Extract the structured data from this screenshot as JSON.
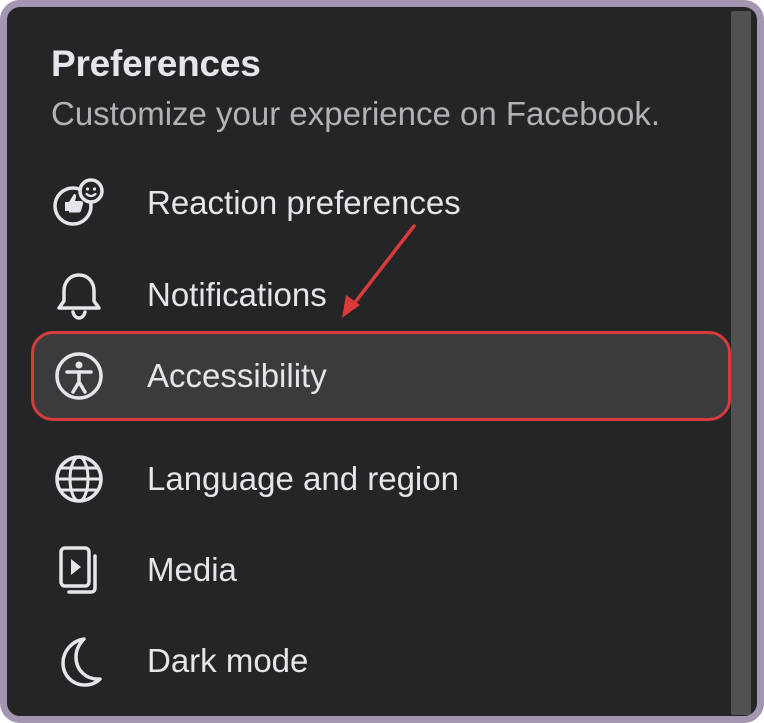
{
  "header": {
    "title": "Preferences",
    "subtitle": "Customize your experience on Facebook."
  },
  "items": [
    {
      "label": "Reaction preferences",
      "icon": "reaction-icon"
    },
    {
      "label": "Notifications",
      "icon": "bell-icon"
    },
    {
      "label": "Accessibility",
      "icon": "accessibility-icon",
      "selected": true
    },
    {
      "label": "Language and region",
      "icon": "globe-icon"
    },
    {
      "label": "Media",
      "icon": "media-icon"
    },
    {
      "label": "Dark mode",
      "icon": "moon-icon"
    }
  ],
  "colors": {
    "background": "#242526",
    "text": "#e4e6eb",
    "subtext": "#b0b3b8",
    "highlight": "#d93a3a",
    "frame": "#a396b0"
  }
}
